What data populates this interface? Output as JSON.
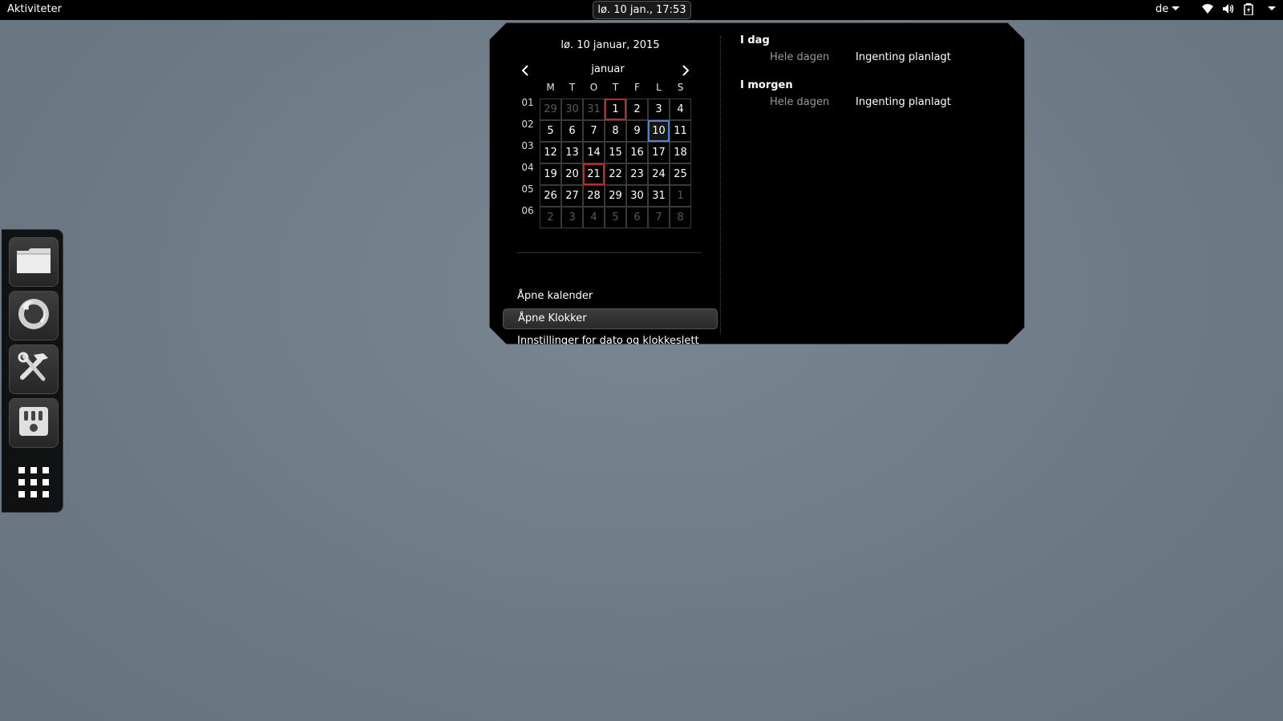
{
  "topbar": {
    "activities": "Aktiviteter",
    "clock": "lø. 10 jan., 17:53",
    "language": "de",
    "icons": [
      "wifi-icon",
      "volume-icon",
      "battery-icon"
    ]
  },
  "dash": {
    "items": [
      "files-icon",
      "firefox-icon",
      "tools-icon",
      "mixer-icon"
    ],
    "show_apps": "apps-grid-icon"
  },
  "calendar": {
    "date_title": "lø. 10 januar, 2015",
    "month": "januar",
    "weekdays": [
      "M",
      "T",
      "O",
      "T",
      "F",
      "L",
      "S"
    ],
    "week_numbers": [
      "01",
      "02",
      "03",
      "04",
      "05",
      "06"
    ],
    "weeks": [
      [
        "29",
        "30",
        "31",
        "1",
        "2",
        "3",
        "4"
      ],
      [
        "5",
        "6",
        "7",
        "8",
        "9",
        "10",
        "11"
      ],
      [
        "12",
        "13",
        "14",
        "15",
        "16",
        "17",
        "18"
      ],
      [
        "19",
        "20",
        "21",
        "22",
        "23",
        "24",
        "25"
      ],
      [
        "26",
        "27",
        "28",
        "29",
        "30",
        "31",
        "1"
      ],
      [
        "2",
        "3",
        "4",
        "5",
        "6",
        "7",
        "8"
      ]
    ],
    "today": "10",
    "holiday_color": "#c0292b",
    "today_color": "#5581c7"
  },
  "menu": {
    "open_calendar": "Åpne kalender",
    "open_clocks": "Åpne Klokker",
    "date_settings": "Innstillinger for dato og klokkeslett"
  },
  "events": {
    "today_heading": "I dag",
    "today_time": "Hele dagen",
    "today_desc": "Ingenting planlagt",
    "tomorrow_heading": "I morgen",
    "tomorrow_time": "Hele dagen",
    "tomorrow_desc": "Ingenting planlagt"
  }
}
